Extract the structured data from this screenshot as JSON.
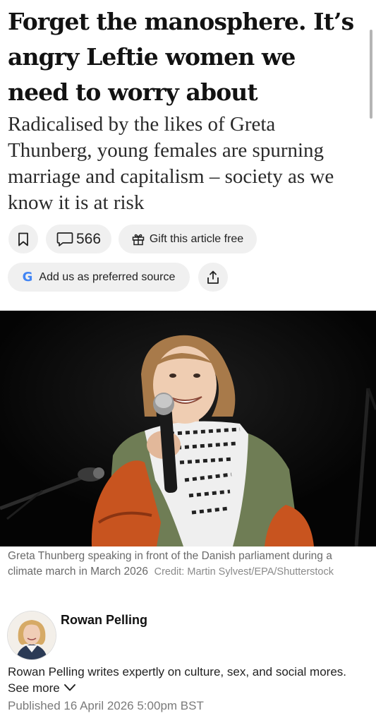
{
  "article": {
    "headline": "Forget the manosphere. It’s angry Leftie women we need to worry about",
    "standfirst": "Radicalised by the likes of Greta Thunberg, young females are spurning marriage and capitalism – society as we know it is at risk"
  },
  "actions": {
    "bookmark_icon": "bookmark-icon",
    "comment_icon": "comment-icon",
    "comment_count": "566",
    "gift_icon": "gift-icon",
    "gift_label": "Gift this article free",
    "source_logo": "G",
    "source_label": "Add us as preferred source",
    "share_icon": "share-icon"
  },
  "photo": {
    "caption": "Greta Thunberg speaking in front of the Danish parliament during a climate march in March 2026",
    "credit": "Credit: Martin Sylvest/EPA/Shutterstock"
  },
  "author": {
    "name": "Rowan Pelling",
    "bio": "Rowan Pelling writes expertly on culture, sex, and social mores.",
    "see_more": "See more",
    "published": "Published 16 April 2026 5:00pm BST"
  },
  "colors": {
    "pill_background": "#f0f0f0",
    "photo_background": "#060606",
    "jacket_orange": "#c8541f",
    "google_blue": "#4285f4"
  }
}
